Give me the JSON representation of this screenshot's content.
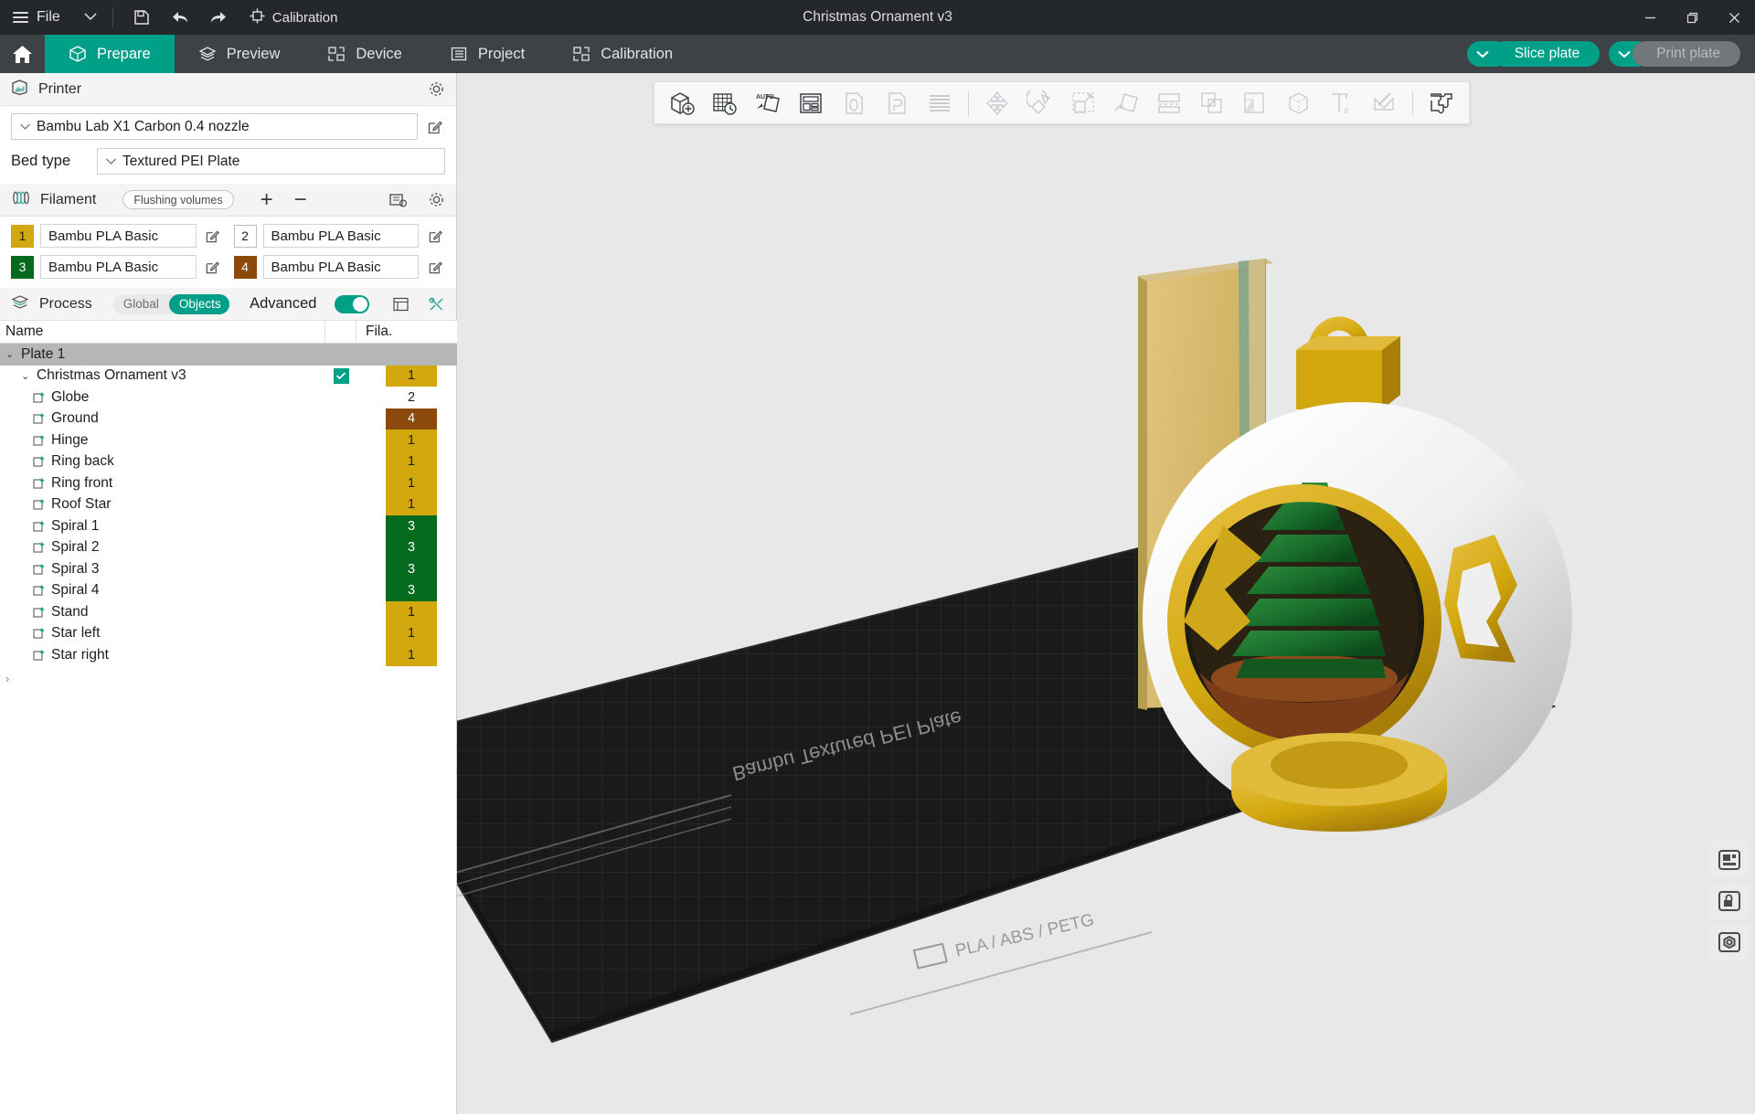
{
  "window": {
    "title": "Christmas Ornament v3",
    "minimize_label": "Minimize",
    "restore_label": "Restore",
    "close_label": "Close"
  },
  "titlebar": {
    "file_label": "File",
    "dropdown_caret": "⌄",
    "save_icon": "save-icon",
    "undo_icon": "undo-icon",
    "redo_icon": "redo-icon",
    "calibration_label": "Calibration"
  },
  "tabs": {
    "home_icon": "home-icon",
    "items": [
      {
        "label": "Prepare",
        "icon": "cube-icon",
        "active": true
      },
      {
        "label": "Preview",
        "icon": "layers-icon",
        "active": false
      },
      {
        "label": "Device",
        "icon": "device-icon",
        "active": false
      },
      {
        "label": "Project",
        "icon": "list-icon",
        "active": false
      },
      {
        "label": "Calibration",
        "icon": "calibration-icon",
        "active": false
      }
    ],
    "slice_plate_label": "Slice plate",
    "print_plate_label": "Print plate",
    "caret_glyph": "⌄"
  },
  "printer": {
    "section_label": "Printer",
    "section_icon": "printer-icon",
    "settings_icon": "gear-icon",
    "preset_value": "Bambu Lab X1 Carbon 0.4 nozzle",
    "edit_icon": "edit-icon",
    "bed_type_label": "Bed type",
    "bed_type_value": "Textured PEI Plate"
  },
  "filament": {
    "section_label": "Filament",
    "section_icon": "filament-icon",
    "flushing_volumes_label": "Flushing volumes",
    "add_label": "+",
    "remove_label": "−",
    "sync_icon": "sync-ams-icon",
    "settings_icon": "gear-icon",
    "items": [
      {
        "index": "1",
        "name": "Bambu PLA Basic",
        "color": "#D3A80E",
        "text_color": "#1d1d1d"
      },
      {
        "index": "2",
        "name": "Bambu PLA Basic",
        "color": "#FFFFFF",
        "text_color": "#1d1d1d"
      },
      {
        "index": "3",
        "name": "Bambu PLA Basic",
        "color": "#046A1D",
        "text_color": "#ffffff"
      },
      {
        "index": "4",
        "name": "Bambu PLA Basic",
        "color": "#8B4A0C",
        "text_color": "#ffffff"
      }
    ]
  },
  "process": {
    "section_label": "Process",
    "section_icon": "process-icon",
    "scope_global_label": "Global",
    "scope_objects_label": "Objects",
    "scope_selected": "Objects",
    "advanced_label": "Advanced",
    "advanced_on": true,
    "list_icon": "list-view-icon",
    "tools_icon": "object-tools-icon"
  },
  "object_table": {
    "col_name": "Name",
    "col_fila": "Fila.",
    "plate_label": "Plate 1",
    "root": {
      "label": "Christmas Ornament v3",
      "checked": true,
      "fila": "1",
      "fila_color": "#D3A80E",
      "fila_text": "#1d1d1d"
    },
    "children": [
      {
        "label": "Globe",
        "fila": "2",
        "fila_color": "#FFFFFF",
        "fila_text": "#1d1d1d"
      },
      {
        "label": "Ground",
        "fila": "4",
        "fila_color": "#8B4A0C",
        "fila_text": "#ffffff"
      },
      {
        "label": "Hinge",
        "fila": "1",
        "fila_color": "#D3A80E",
        "fila_text": "#1d1d1d"
      },
      {
        "label": "Ring back",
        "fila": "1",
        "fila_color": "#D3A80E",
        "fila_text": "#1d1d1d"
      },
      {
        "label": "Ring front",
        "fila": "1",
        "fila_color": "#D3A80E",
        "fila_text": "#1d1d1d"
      },
      {
        "label": "Roof Star",
        "fila": "1",
        "fila_color": "#D3A80E",
        "fila_text": "#1d1d1d"
      },
      {
        "label": "Spiral 1",
        "fila": "3",
        "fila_color": "#046A1D",
        "fila_text": "#ffffff"
      },
      {
        "label": "Spiral 2",
        "fila": "3",
        "fila_color": "#046A1D",
        "fila_text": "#ffffff"
      },
      {
        "label": "Spiral 3",
        "fila": "3",
        "fila_color": "#046A1D",
        "fila_text": "#ffffff"
      },
      {
        "label": "Spiral 4",
        "fila": "3",
        "fila_color": "#046A1D",
        "fila_text": "#ffffff"
      },
      {
        "label": "Stand",
        "fila": "1",
        "fila_color": "#D3A80E",
        "fila_text": "#1d1d1d"
      },
      {
        "label": "Star left",
        "fila": "1",
        "fila_color": "#D3A80E",
        "fila_text": "#1d1d1d"
      },
      {
        "label": "Star right",
        "fila": "1",
        "fila_color": "#D3A80E",
        "fila_text": "#1d1d1d"
      }
    ],
    "expand_caret": "›",
    "twisty_open": "⌄"
  },
  "viewport_toolbar": {
    "tools": [
      {
        "name": "add-object-icon",
        "enabled": true
      },
      {
        "name": "add-plate-icon",
        "enabled": true
      },
      {
        "name": "auto-arrange-icon",
        "enabled": true
      },
      {
        "name": "auto-orient-icon",
        "enabled": true
      },
      {
        "name": "variable-layer-height-icon",
        "enabled": false
      },
      {
        "name": "paint-support-icon",
        "enabled": false
      },
      {
        "name": "seam-painting-icon",
        "enabled": false
      },
      {
        "name": "move-icon",
        "enabled": false
      },
      {
        "name": "rotate-icon",
        "enabled": false
      },
      {
        "name": "scale-icon",
        "enabled": false
      },
      {
        "name": "place-on-face-icon",
        "enabled": false
      },
      {
        "name": "cut-icon",
        "enabled": false
      },
      {
        "name": "mesh-boolean-icon",
        "enabled": false
      },
      {
        "name": "support-painting-icon",
        "enabled": false
      },
      {
        "name": "fuzzy-skin-icon",
        "enabled": false
      },
      {
        "name": "text-emboss-icon",
        "enabled": false
      },
      {
        "name": "svg-tool-icon",
        "enabled": false
      },
      {
        "name": "assembly-view-icon",
        "enabled": true
      }
    ]
  },
  "plate": {
    "bed_label_text": "Bambu Textured PEI Plate",
    "bed_material_text": "PLA / ABS / PETG",
    "corner_icons": [
      {
        "name": "bed-type-icon"
      },
      {
        "name": "lock-plate-icon"
      },
      {
        "name": "plate-settings-icon"
      }
    ],
    "model_name": "Christmas Ornament v3",
    "colors": {
      "globe": "#efefef",
      "ring_gold": "#D3A80E",
      "tree_green": "#186b2a",
      "ground_brown": "#7a3c18",
      "slab_gold": "#d6b35a"
    }
  }
}
